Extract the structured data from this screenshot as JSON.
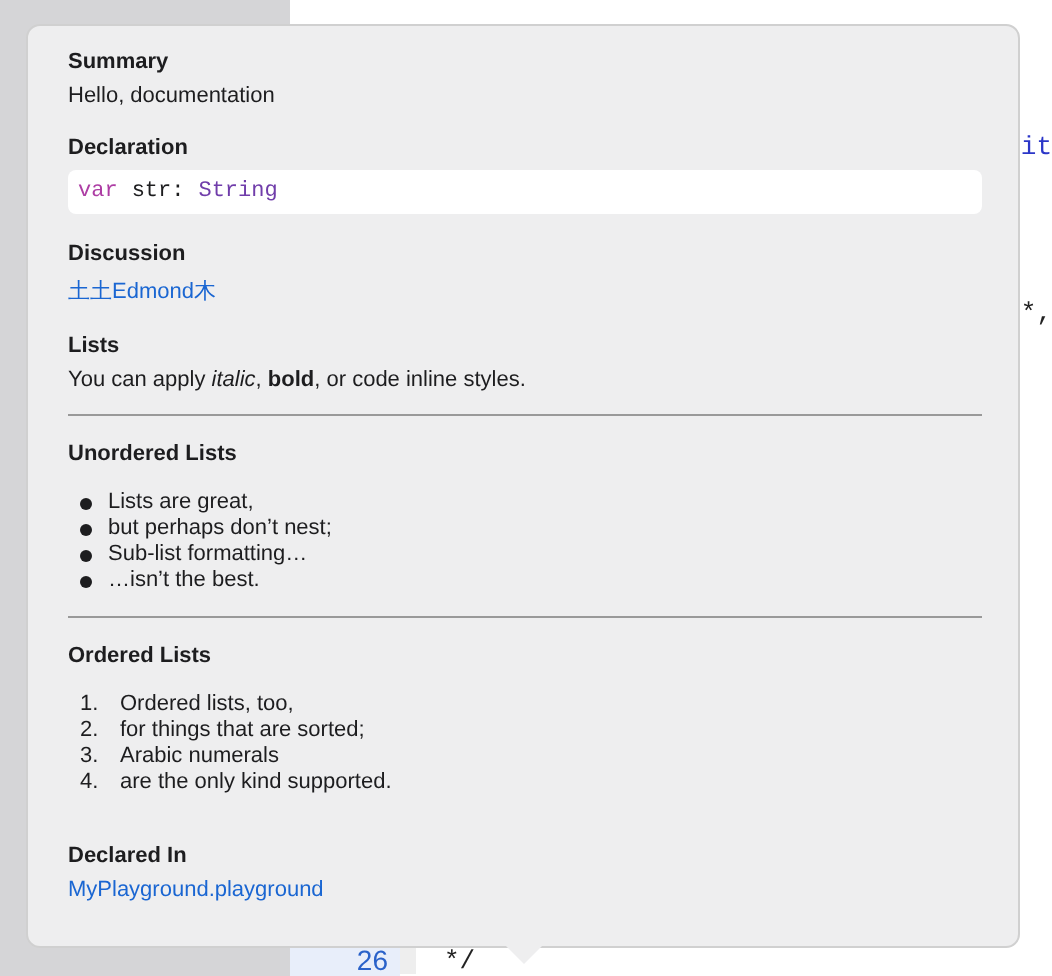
{
  "editor": {
    "fragments": [
      "it",
      "*,"
    ],
    "bottom_line": {
      "number": "26",
      "code": "*/"
    }
  },
  "popover": {
    "sections": [
      {
        "heading": "Summary",
        "kind": "text",
        "text": "Hello, documentation",
        "divider_after": false
      },
      {
        "heading": "Declaration",
        "kind": "code",
        "tokens": [
          {
            "text": "var",
            "kind": "keyword"
          },
          {
            "text": "str:",
            "kind": "plain"
          },
          {
            "text": "String",
            "kind": "type"
          }
        ],
        "divider_after": false
      },
      {
        "heading": "Discussion",
        "kind": "link",
        "text": "土土Edmond木",
        "divider_after": false
      },
      {
        "heading": "Lists",
        "kind": "text",
        "text": "You can apply *italic*, **bold**, or code inline styles.",
        "divider_after": true
      },
      {
        "heading": "Unordered Lists",
        "kind": "bullets",
        "items": [
          "Lists are great,",
          "but perhaps don’t nest;",
          "Sub-list formatting…",
          "…isn’t the best."
        ],
        "divider_after": true
      },
      {
        "heading": "Ordered Lists",
        "kind": "numbered",
        "items": [
          {
            "marker": "1.",
            "text": "Ordered lists, too,"
          },
          {
            "marker": "2.",
            "text": "for things that are sorted;"
          },
          {
            "marker": "3.",
            "text": "Arabic numerals"
          },
          {
            "marker": "4.",
            "text": "are the only kind supported."
          }
        ],
        "divider_after": false
      },
      {
        "heading": "Declared In",
        "kind": "link",
        "text": "MyPlayground.playground",
        "divider_after": false
      }
    ]
  }
}
